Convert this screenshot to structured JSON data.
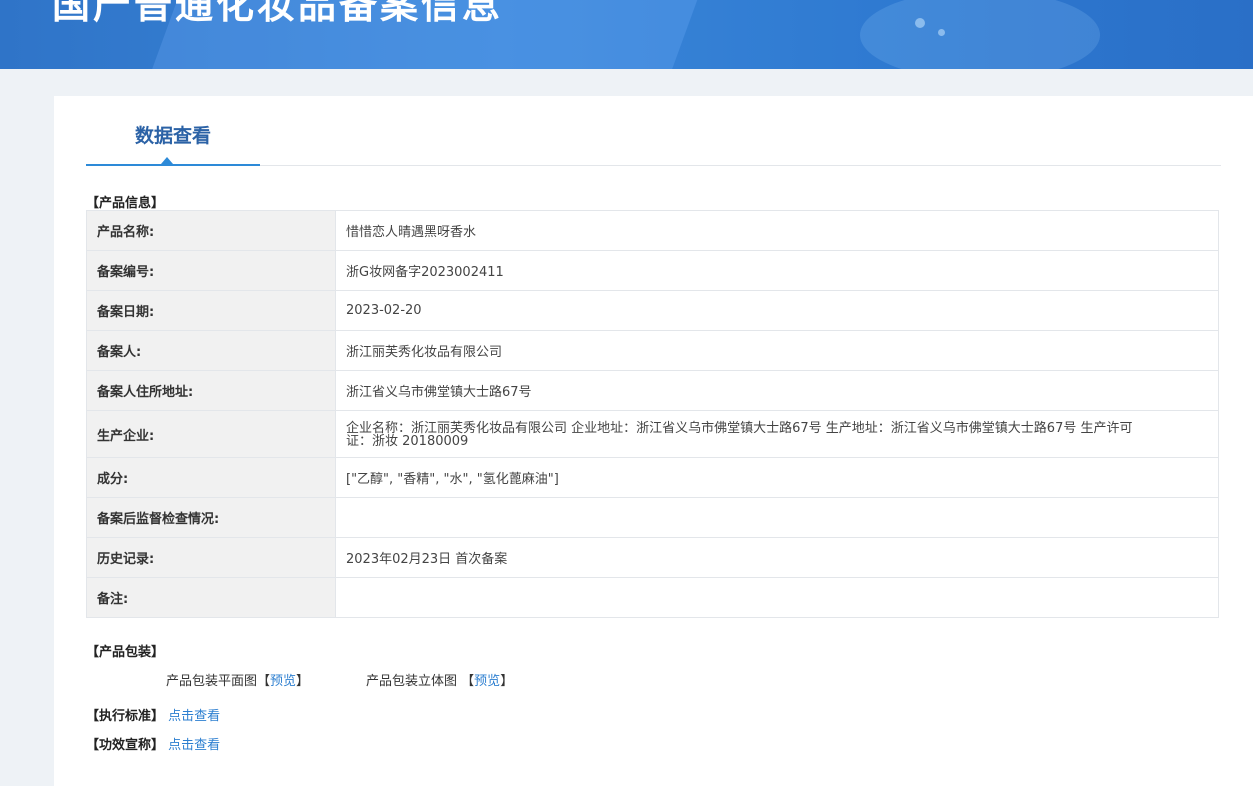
{
  "banner": {
    "title": "国产普通化妆品备案信息"
  },
  "tabs": [
    {
      "label": "数据查看"
    }
  ],
  "product_info": {
    "section_title": "【产品信息】",
    "rows": [
      {
        "label": "产品名称:",
        "value": "惜惜恋人晴遇黑呀香水"
      },
      {
        "label": "备案编号:",
        "value": "浙G妆网备字2023002411"
      },
      {
        "label": "备案日期:",
        "value": "2023-02-20"
      },
      {
        "label": "备案人:",
        "value": "浙江丽芙秀化妆品有限公司"
      },
      {
        "label": "备案人住所地址:",
        "value": "浙江省义乌市佛堂镇大士路67号"
      },
      {
        "label": "生产企业:",
        "value": "企业名称：浙江丽芙秀化妆品有限公司 企业地址：浙江省义乌市佛堂镇大士路67号 生产地址：浙江省义乌市佛堂镇大士路67号 生产许可证：浙妆 20180009"
      },
      {
        "label": "成分:",
        "value": "[\"乙醇\", \"香精\", \"水\", \"氢化蓖麻油\"]"
      },
      {
        "label": "备案后监督检查情况:",
        "value": ""
      },
      {
        "label": "历史记录:",
        "value": "2023年02月23日 首次备案"
      },
      {
        "label": "备注:",
        "value": ""
      }
    ]
  },
  "packaging": {
    "section_title": "【产品包装】",
    "flat_label": "产品包装平面图",
    "solid_label": "产品包装立体图",
    "bracket_open": "【",
    "bracket_close": "】",
    "preview_link": "预览"
  },
  "standard": {
    "label": "【执行标准】",
    "link": "点击查看"
  },
  "efficacy": {
    "label": "【功效宣称】",
    "link": "点击查看"
  }
}
